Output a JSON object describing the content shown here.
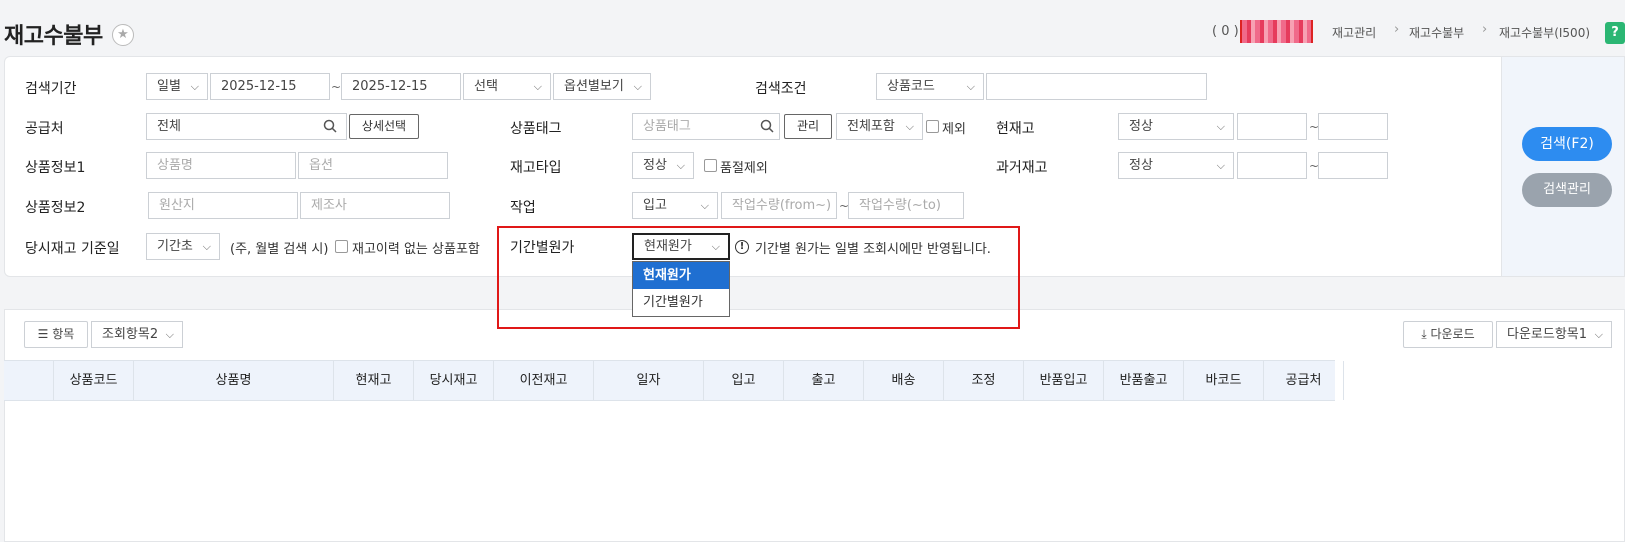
{
  "header": {
    "title": "재고수불부",
    "user_count": "( 0 )",
    "breadcrumbs": [
      "재고관리",
      "재고수불부",
      "재고수불부(I500)"
    ],
    "help": "?"
  },
  "search": {
    "period": {
      "label": "검색기간",
      "unit": "일별",
      "from": "2025-12-15",
      "to": "2025-12-15",
      "select": "선택",
      "option_view": "옵션별보기"
    },
    "condition": {
      "label": "검색조건",
      "field": "상품코드",
      "value": ""
    },
    "supplier": {
      "label": "공급처",
      "value": "전체",
      "detail_button": "상세선택"
    },
    "tag": {
      "label": "상품태그",
      "placeholder": "상품태그",
      "manage_button": "관리",
      "include": "전체포함",
      "exclude_label": "제외"
    },
    "current_stock": {
      "label": "현재고",
      "status": "정상",
      "from": "",
      "to": ""
    },
    "product_info1": {
      "label": "상품정보1",
      "name_placeholder": "상품명",
      "option_placeholder": "옵션"
    },
    "stock_type": {
      "label": "재고타입",
      "value": "정상",
      "soldout_label": "품절제외"
    },
    "past_stock": {
      "label": "과거재고",
      "status": "정상",
      "from": "",
      "to": ""
    },
    "product_info2": {
      "label": "상품정보2",
      "origin_placeholder": "원산지",
      "maker_placeholder": "제조사"
    },
    "work": {
      "label": "작업",
      "type": "입고",
      "from_placeholder": "작업수량(from~)",
      "to_placeholder": "작업수량(~to)"
    },
    "base_date": {
      "label": "당시재고 기준일",
      "value": "기간초",
      "note": "(주, 월별 검색 시)",
      "no_history_label": "재고이력 없는 상품포함"
    },
    "period_cost": {
      "label": "기간별원가",
      "value": "현재원가",
      "info": "기간별 원가는 일별 조회시에만 반영됩니다.",
      "options": [
        "현재원가",
        "기간별원가"
      ]
    }
  },
  "side": {
    "search_button": "검색(F2)",
    "search_manage_button": "검색관리"
  },
  "results": {
    "items_button": "항목",
    "query_set": "조회항목2",
    "download_button": "다운로드",
    "download_set": "다운로드항목1",
    "columns": [
      "상품코드",
      "상품명",
      "현재고",
      "당시재고",
      "이전재고",
      "일자",
      "입고",
      "출고",
      "배송",
      "조정",
      "반품입고",
      "반품출고",
      "바코드",
      "공급처"
    ]
  }
}
